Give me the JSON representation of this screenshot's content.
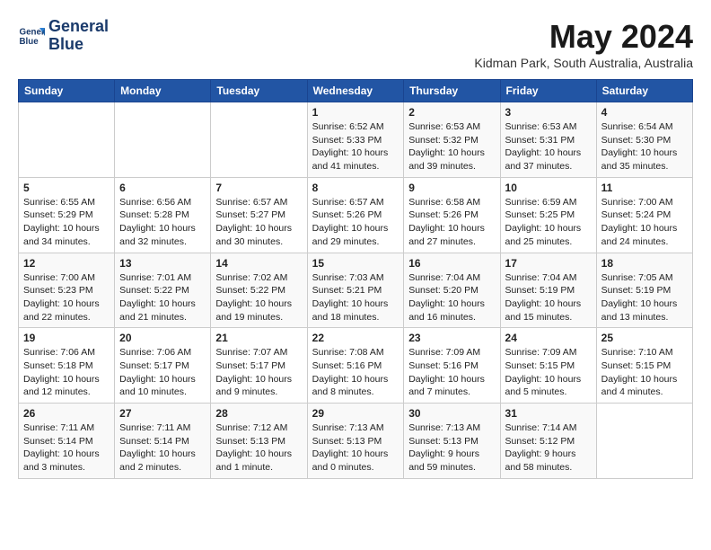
{
  "header": {
    "logo_line1": "General",
    "logo_line2": "Blue",
    "month": "May 2024",
    "location": "Kidman Park, South Australia, Australia"
  },
  "columns": [
    "Sunday",
    "Monday",
    "Tuesday",
    "Wednesday",
    "Thursday",
    "Friday",
    "Saturday"
  ],
  "weeks": [
    [
      {
        "day": "",
        "info": ""
      },
      {
        "day": "",
        "info": ""
      },
      {
        "day": "",
        "info": ""
      },
      {
        "day": "1",
        "info": "Sunrise: 6:52 AM\nSunset: 5:33 PM\nDaylight: 10 hours\nand 41 minutes."
      },
      {
        "day": "2",
        "info": "Sunrise: 6:53 AM\nSunset: 5:32 PM\nDaylight: 10 hours\nand 39 minutes."
      },
      {
        "day": "3",
        "info": "Sunrise: 6:53 AM\nSunset: 5:31 PM\nDaylight: 10 hours\nand 37 minutes."
      },
      {
        "day": "4",
        "info": "Sunrise: 6:54 AM\nSunset: 5:30 PM\nDaylight: 10 hours\nand 35 minutes."
      }
    ],
    [
      {
        "day": "5",
        "info": "Sunrise: 6:55 AM\nSunset: 5:29 PM\nDaylight: 10 hours\nand 34 minutes."
      },
      {
        "day": "6",
        "info": "Sunrise: 6:56 AM\nSunset: 5:28 PM\nDaylight: 10 hours\nand 32 minutes."
      },
      {
        "day": "7",
        "info": "Sunrise: 6:57 AM\nSunset: 5:27 PM\nDaylight: 10 hours\nand 30 minutes."
      },
      {
        "day": "8",
        "info": "Sunrise: 6:57 AM\nSunset: 5:26 PM\nDaylight: 10 hours\nand 29 minutes."
      },
      {
        "day": "9",
        "info": "Sunrise: 6:58 AM\nSunset: 5:26 PM\nDaylight: 10 hours\nand 27 minutes."
      },
      {
        "day": "10",
        "info": "Sunrise: 6:59 AM\nSunset: 5:25 PM\nDaylight: 10 hours\nand 25 minutes."
      },
      {
        "day": "11",
        "info": "Sunrise: 7:00 AM\nSunset: 5:24 PM\nDaylight: 10 hours\nand 24 minutes."
      }
    ],
    [
      {
        "day": "12",
        "info": "Sunrise: 7:00 AM\nSunset: 5:23 PM\nDaylight: 10 hours\nand 22 minutes."
      },
      {
        "day": "13",
        "info": "Sunrise: 7:01 AM\nSunset: 5:22 PM\nDaylight: 10 hours\nand 21 minutes."
      },
      {
        "day": "14",
        "info": "Sunrise: 7:02 AM\nSunset: 5:22 PM\nDaylight: 10 hours\nand 19 minutes."
      },
      {
        "day": "15",
        "info": "Sunrise: 7:03 AM\nSunset: 5:21 PM\nDaylight: 10 hours\nand 18 minutes."
      },
      {
        "day": "16",
        "info": "Sunrise: 7:04 AM\nSunset: 5:20 PM\nDaylight: 10 hours\nand 16 minutes."
      },
      {
        "day": "17",
        "info": "Sunrise: 7:04 AM\nSunset: 5:19 PM\nDaylight: 10 hours\nand 15 minutes."
      },
      {
        "day": "18",
        "info": "Sunrise: 7:05 AM\nSunset: 5:19 PM\nDaylight: 10 hours\nand 13 minutes."
      }
    ],
    [
      {
        "day": "19",
        "info": "Sunrise: 7:06 AM\nSunset: 5:18 PM\nDaylight: 10 hours\nand 12 minutes."
      },
      {
        "day": "20",
        "info": "Sunrise: 7:06 AM\nSunset: 5:17 PM\nDaylight: 10 hours\nand 10 minutes."
      },
      {
        "day": "21",
        "info": "Sunrise: 7:07 AM\nSunset: 5:17 PM\nDaylight: 10 hours\nand 9 minutes."
      },
      {
        "day": "22",
        "info": "Sunrise: 7:08 AM\nSunset: 5:16 PM\nDaylight: 10 hours\nand 8 minutes."
      },
      {
        "day": "23",
        "info": "Sunrise: 7:09 AM\nSunset: 5:16 PM\nDaylight: 10 hours\nand 7 minutes."
      },
      {
        "day": "24",
        "info": "Sunrise: 7:09 AM\nSunset: 5:15 PM\nDaylight: 10 hours\nand 5 minutes."
      },
      {
        "day": "25",
        "info": "Sunrise: 7:10 AM\nSunset: 5:15 PM\nDaylight: 10 hours\nand 4 minutes."
      }
    ],
    [
      {
        "day": "26",
        "info": "Sunrise: 7:11 AM\nSunset: 5:14 PM\nDaylight: 10 hours\nand 3 minutes."
      },
      {
        "day": "27",
        "info": "Sunrise: 7:11 AM\nSunset: 5:14 PM\nDaylight: 10 hours\nand 2 minutes."
      },
      {
        "day": "28",
        "info": "Sunrise: 7:12 AM\nSunset: 5:13 PM\nDaylight: 10 hours\nand 1 minute."
      },
      {
        "day": "29",
        "info": "Sunrise: 7:13 AM\nSunset: 5:13 PM\nDaylight: 10 hours\nand 0 minutes."
      },
      {
        "day": "30",
        "info": "Sunrise: 7:13 AM\nSunset: 5:13 PM\nDaylight: 9 hours\nand 59 minutes."
      },
      {
        "day": "31",
        "info": "Sunrise: 7:14 AM\nSunset: 5:12 PM\nDaylight: 9 hours\nand 58 minutes."
      },
      {
        "day": "",
        "info": ""
      }
    ]
  ]
}
